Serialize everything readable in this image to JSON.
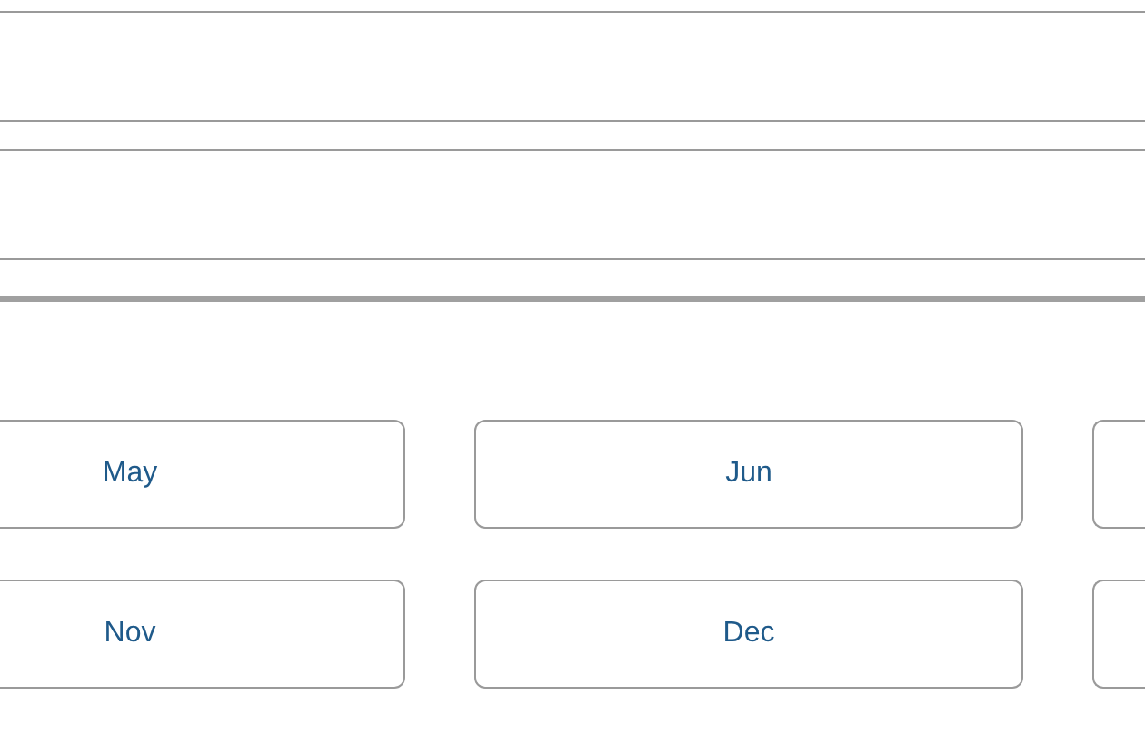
{
  "months": [
    {
      "kind": "label",
      "label": "May"
    },
    {
      "kind": "label",
      "label": "Jun"
    },
    {
      "kind": "blank"
    },
    {
      "kind": "label",
      "label": "Nov"
    },
    {
      "kind": "label",
      "label": "Dec"
    },
    {
      "kind": "blank"
    }
  ]
}
